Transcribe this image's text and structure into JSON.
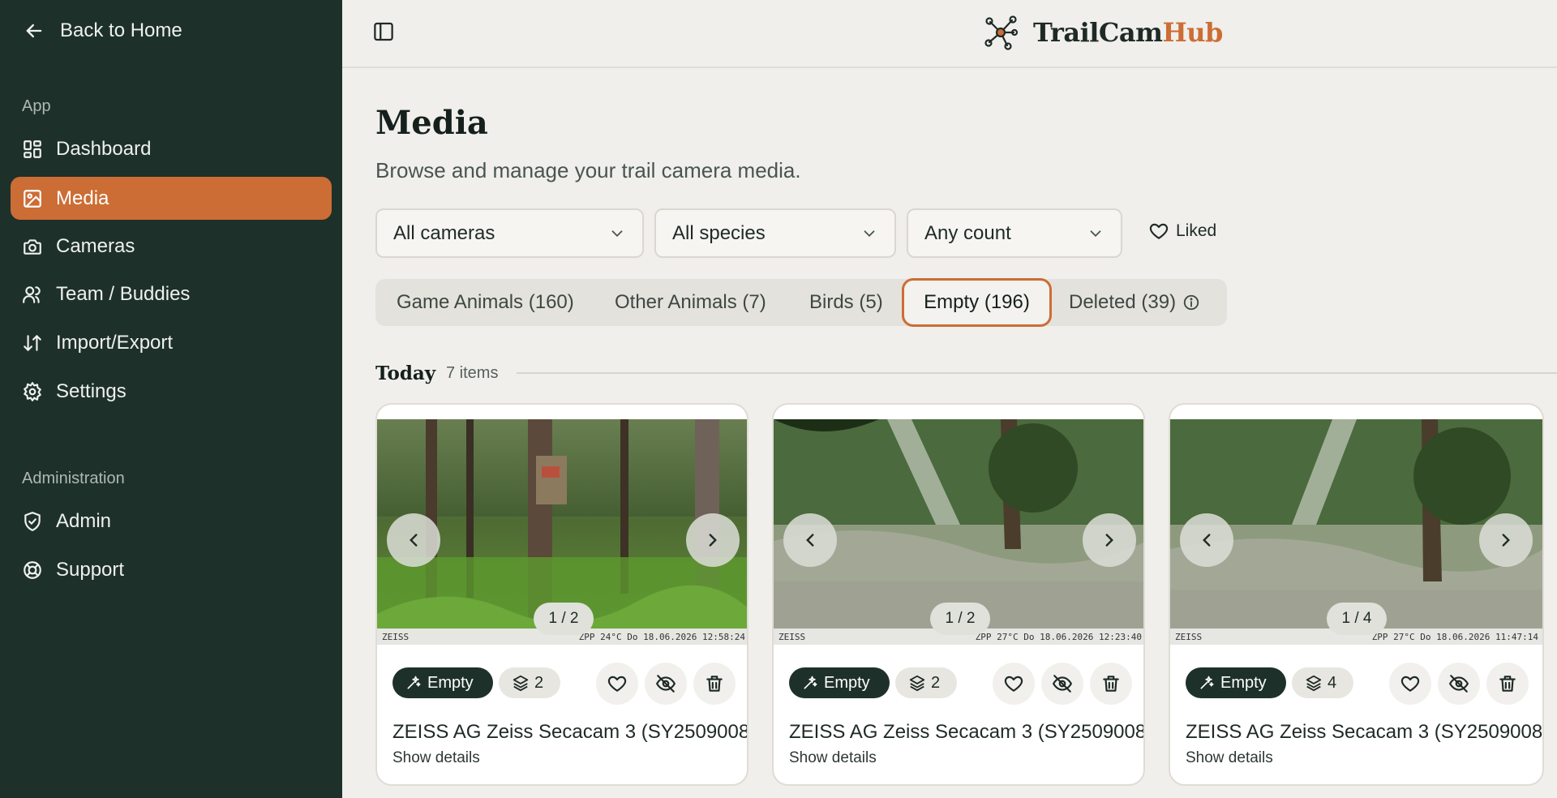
{
  "sidebar": {
    "back_label": "Back to Home",
    "section_app": "App",
    "section_admin": "Administration",
    "items": [
      {
        "label": "Dashboard",
        "icon": "grid-icon",
        "active": false
      },
      {
        "label": "Media",
        "icon": "image-icon",
        "active": true
      },
      {
        "label": "Cameras",
        "icon": "camera-icon",
        "active": false
      },
      {
        "label": "Team / Buddies",
        "icon": "users-icon",
        "active": false
      },
      {
        "label": "Import/Export",
        "icon": "arrows-updown-icon",
        "active": false
      },
      {
        "label": "Settings",
        "icon": "gear-icon",
        "active": false
      }
    ],
    "admin_items": [
      {
        "label": "Admin",
        "icon": "shield-check-icon"
      },
      {
        "label": "Support",
        "icon": "lifebuoy-icon"
      }
    ]
  },
  "header": {
    "brand_part1": "TrailCam",
    "brand_part2": "Hub"
  },
  "page": {
    "title": "Media",
    "subtitle": "Browse and manage your trail camera media."
  },
  "filters": {
    "camera": "All cameras",
    "species": "All species",
    "count": "Any count",
    "liked_label": "Liked"
  },
  "tabs": [
    {
      "label": "Game Animals (160)",
      "active": false
    },
    {
      "label": "Other Animals (7)",
      "active": false
    },
    {
      "label": "Birds (5)",
      "active": false
    },
    {
      "label": "Empty (196)",
      "active": true
    },
    {
      "label": "Deleted (39)",
      "active": false
    }
  ],
  "group": {
    "title": "Today",
    "count": "7 items"
  },
  "cards": [
    {
      "pager": "1 / 2",
      "tag": "Empty",
      "stack_count": "2",
      "name": "ZEISS AG Zeiss Secacam 3 (SY2509008",
      "details": "Show details",
      "stamp_brand": "ZEISS",
      "stamp_info": "ZPP 24°C Do 18.06.2026 12:58:24"
    },
    {
      "pager": "1 / 2",
      "tag": "Empty",
      "stack_count": "2",
      "name": "ZEISS AG Zeiss Secacam 3 (SY2509008",
      "details": "Show details",
      "stamp_brand": "ZEISS",
      "stamp_info": "ZPP 27°C Do 18.06.2026 12:23:40"
    },
    {
      "pager": "1 / 4",
      "tag": "Empty",
      "stack_count": "4",
      "name": "ZEISS AG Zeiss Secacam 3 (SY2509008",
      "details": "Show details",
      "stamp_brand": "ZEISS",
      "stamp_info": "ZPP 27°C Do 18.06.2026 11:47:14"
    }
  ],
  "colors": {
    "sidebar_bg": "#1e302a",
    "accent": "#cc6d35",
    "page_bg": "#f0efeb"
  }
}
